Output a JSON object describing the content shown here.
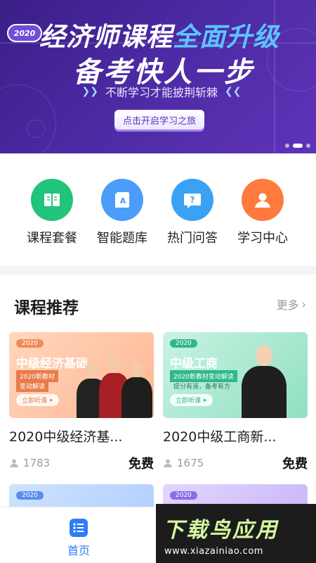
{
  "banner": {
    "badge": "2020",
    "title_a": "经济师课程",
    "title_b": "全面升级",
    "title_2": "备考快人一步",
    "tagline": "不断学习才能披荆斩棘",
    "cta": "点击开启学习之旅"
  },
  "nav": [
    {
      "label": "课程套餐",
      "icon": "book-icon",
      "color": "#22c37a"
    },
    {
      "label": "智能题库",
      "icon": "question-bank-icon",
      "color": "#4b9df9"
    },
    {
      "label": "热门问答",
      "icon": "question-icon",
      "color": "#3aa2f5"
    },
    {
      "label": "学习中心",
      "icon": "user-icon",
      "color": "#ff7a3d"
    }
  ],
  "section": {
    "title": "课程推荐",
    "more": "更多"
  },
  "courses": [
    {
      "year": "2020",
      "banner_title": "中级经济基础",
      "banner_sub": "2020新教材",
      "banner_sub2": "变动解读",
      "pill": "立即听课",
      "name": "2020中级经济基...",
      "views": "1783",
      "price": "免费"
    },
    {
      "year": "2020",
      "banner_title": "中级工商",
      "banner_sub": "2020新教材变动解读",
      "banner_sub2": "提分有道，备考有方",
      "pill": "立即听课",
      "name": "2020中级工商新...",
      "views": "1675",
      "price": "免费"
    },
    {
      "year": "2020"
    },
    {
      "year": "2020"
    }
  ],
  "tabbar": {
    "home": "首页"
  },
  "watermark": {
    "logo": "下载鸟应用",
    "url": "www.xiazainiao.com"
  },
  "colors": {
    "accent": "#2f7df6",
    "banner": "#4b2aa3"
  }
}
